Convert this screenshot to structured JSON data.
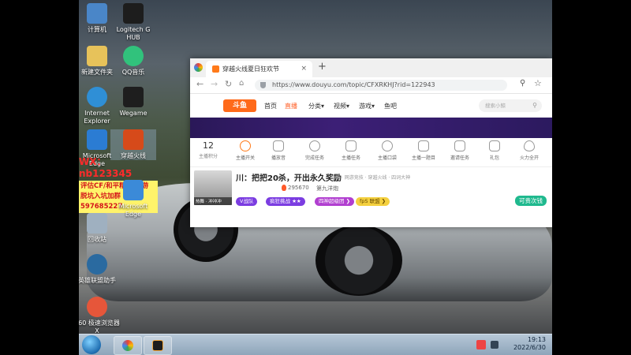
{
  "desktop_icons": [
    {
      "label": "计算机",
      "name": "computer-icon",
      "color": "#4a86c8"
    },
    {
      "label": "Logitech G HUB",
      "name": "logitech-ghub-icon",
      "color": "#1d1d1d"
    },
    {
      "label": "新建文件夹",
      "name": "folder-icon",
      "color": "#e7c25a"
    },
    {
      "label": "QQ音乐",
      "name": "qq-music-icon",
      "color": "#31c27c"
    },
    {
      "label": "Internet Explorer",
      "name": "ie-icon",
      "color": "#2f8fd6"
    },
    {
      "label": "Wegame",
      "name": "wegame-icon",
      "color": "#1e1e1e"
    },
    {
      "label": "Microsoft Edge",
      "name": "edge-icon",
      "color": "#2b7cd3"
    },
    {
      "label": "穿越火线",
      "name": "crossfire-icon",
      "color": "#d64a1a"
    },
    {
      "label": "Microsoft Edge",
      "name": "edge-icon-2",
      "color": "#3b8ad8"
    },
    {
      "label": "回收站",
      "name": "recycle-bin-icon",
      "color": "#9fb0c0"
    },
    {
      "label": "英雄联盟助手",
      "name": "lol-assistant-icon",
      "color": "#2a6aa0"
    },
    {
      "label": "360 极速浏览器X",
      "name": "360-browser-icon",
      "color": "#e6563a"
    }
  ],
  "promo": {
    "wx": "WX：nb123345",
    "line1": "评估CF/和平精英/手游",
    "line2": "脱坑入坑加群 597685227"
  },
  "browser": {
    "tab_title": "穿越火线夏日狂欢节",
    "url": "https://www.douyu.com/topic/CFXRKHJ?rid=122943",
    "logo": "斗鱼",
    "nav": [
      "首页",
      "直播",
      "分类▾",
      "视频▾",
      "游戏▾",
      "鱼吧"
    ],
    "search_placeholder": "搜索小鲸",
    "tasks_count": "12",
    "tasks_count_label": "主播积分",
    "tasks": [
      {
        "label": "主播开关"
      },
      {
        "label": "播放音"
      },
      {
        "label": "完成任务"
      },
      {
        "label": "主播任务"
      },
      {
        "label": "主播口袋"
      },
      {
        "label": "主播一题目"
      },
      {
        "label": "邀请任务"
      },
      {
        "label": "礼包"
      },
      {
        "label": "火力全开"
      }
    ],
    "stream": {
      "thumb_caption": "热舞 · 冲冲冲",
      "title": "川：把把20杀，开出永久奖励",
      "tags": "单枪 · 网游竞技 · 穿越火线 · 四词大神",
      "viewers": "295670",
      "category": "第九洋炮",
      "badge_left": "V战队",
      "pill1": "疯狂挑战 ★★",
      "pill2": "四神超级团 ❯",
      "pill3": "fpS 联盟 ❯",
      "follow": "可贵次钱"
    }
  },
  "taskbar": {
    "time": "19:13",
    "date": "2022/6/30"
  }
}
